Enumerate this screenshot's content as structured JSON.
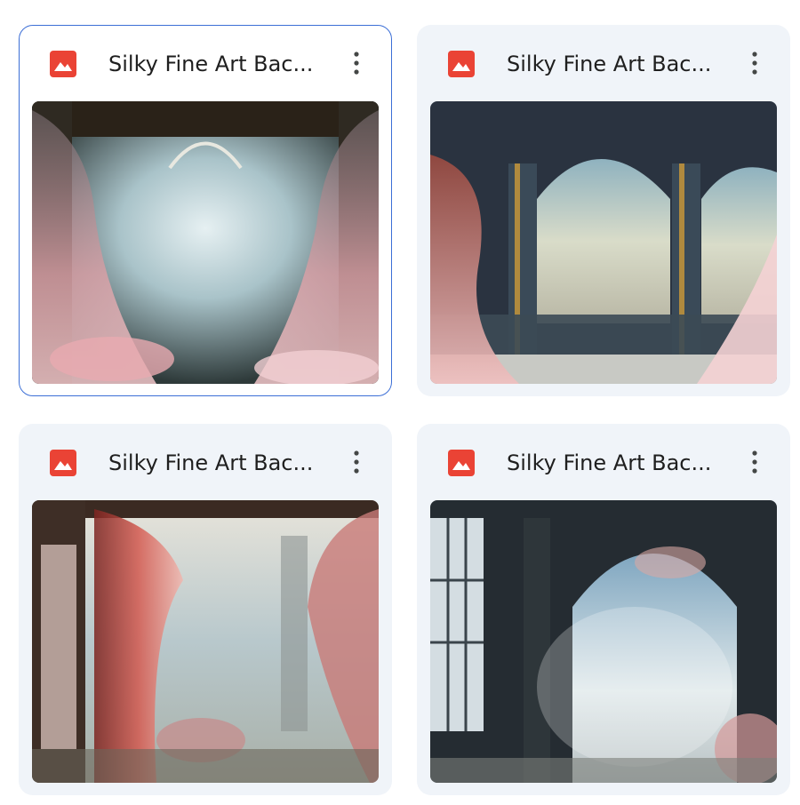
{
  "files": [
    {
      "name": "Silky Fine Art Bac...",
      "selected": true
    },
    {
      "name": "Silky Fine Art Bac...",
      "selected": false
    },
    {
      "name": "Silky Fine Art Bac...",
      "selected": false
    },
    {
      "name": "Silky Fine Art Bac...",
      "selected": false
    }
  ],
  "icons": {
    "file_type": "image-file-icon",
    "menu": "more-vert-icon"
  },
  "colors": {
    "image_icon_red": "#ea4335",
    "card_background": "#f0f4f9",
    "selected_border": "#3c6fd6"
  }
}
